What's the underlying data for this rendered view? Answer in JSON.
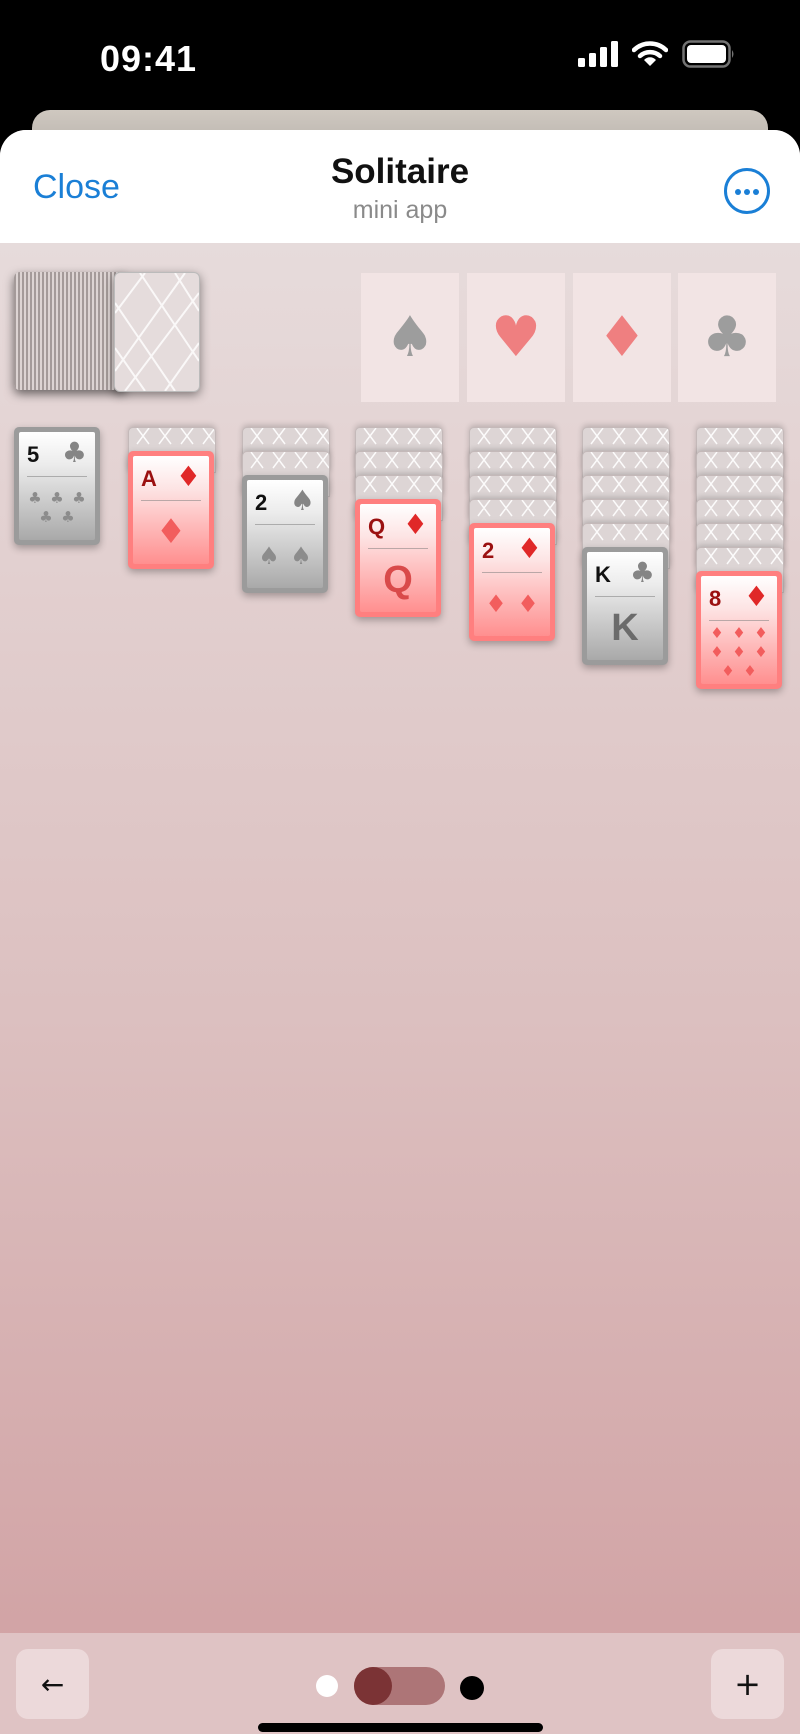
{
  "status_bar": {
    "time": "09:41"
  },
  "header": {
    "close_label": "Close",
    "title": "Solitaire",
    "subtitle": "mini app"
  },
  "foundations": [
    {
      "suit": "spade",
      "glyph": "♠",
      "color": "#9d9d9d"
    },
    {
      "suit": "heart",
      "glyph": "♥",
      "color": "#ef7f80"
    },
    {
      "suit": "diamond",
      "glyph": "♦",
      "color": "#ef7f80"
    },
    {
      "suit": "club",
      "glyph": "♣",
      "color": "#9d9d9d"
    }
  ],
  "tableau": [
    {
      "hidden": 0,
      "top": {
        "rank": "5",
        "suit": "♣",
        "color": "black"
      }
    },
    {
      "hidden": 1,
      "top": {
        "rank": "A",
        "suit": "♦",
        "color": "red"
      }
    },
    {
      "hidden": 2,
      "top": {
        "rank": "2",
        "suit": "♠",
        "color": "black"
      }
    },
    {
      "hidden": 3,
      "top": {
        "rank": "Q",
        "suit": "♦",
        "color": "red"
      }
    },
    {
      "hidden": 4,
      "top": {
        "rank": "2",
        "suit": "♦",
        "color": "red"
      }
    },
    {
      "hidden": 5,
      "top": {
        "rank": "K",
        "suit": "♣",
        "color": "black"
      }
    },
    {
      "hidden": 6,
      "top": {
        "rank": "8",
        "suit": "♦",
        "color": "red"
      }
    }
  ],
  "bottom_bar": {
    "back_glyph": "←",
    "add_glyph": "+"
  },
  "theme": {
    "light": "#ffffff",
    "accent": "#7b3335",
    "dark": "#000000"
  }
}
